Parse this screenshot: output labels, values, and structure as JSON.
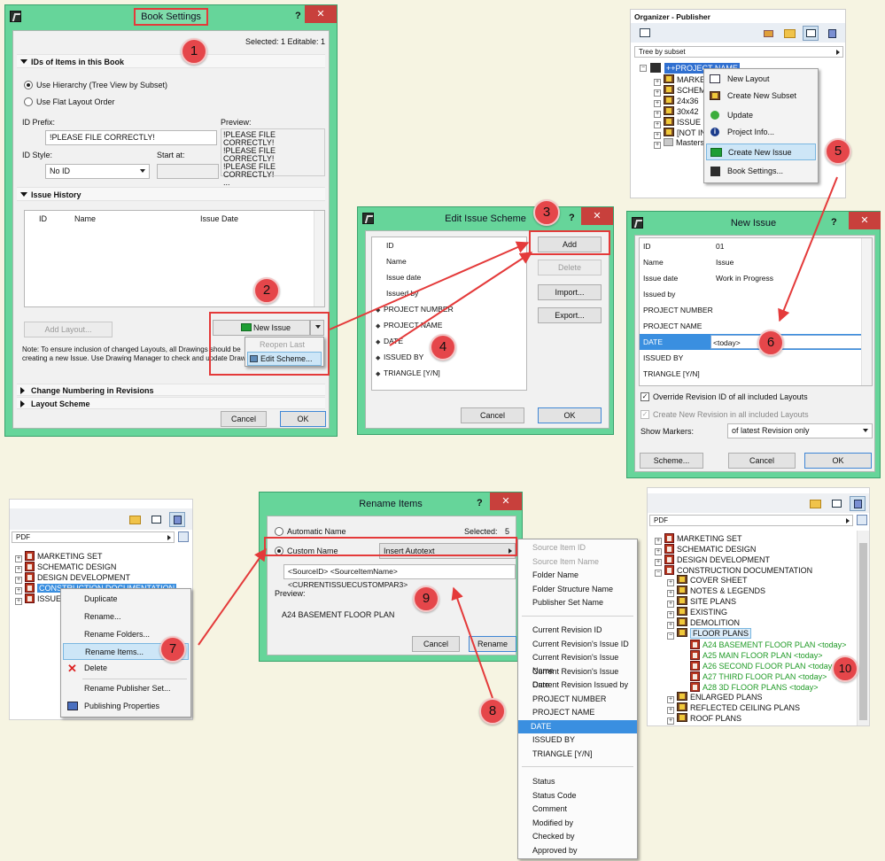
{
  "book_settings": {
    "title": "Book Settings",
    "help": "?",
    "close": "✕",
    "selected_info": "Selected: 1  Editable: 1",
    "ids_section": "IDs of Items in this Book",
    "radio_hierarchy": "Use Hierarchy (Tree View by Subset)",
    "radio_flat": "Use Flat Layout Order",
    "id_prefix_label": "ID Prefix:",
    "id_prefix_value": "!PLEASE FILE CORRECTLY!",
    "preview_label": "Preview:",
    "preview_lines": [
      "!PLEASE FILE CORRECTLY!",
      "!PLEASE FILE CORRECTLY!",
      "!PLEASE FILE CORRECTLY!",
      "..."
    ],
    "id_style_label": "ID Style:",
    "id_style_value": "No ID",
    "start_at_label": "Start at:",
    "issue_history": "Issue History",
    "col_id": "ID",
    "col_name": "Name",
    "col_date": "Issue Date",
    "add_layout": "Add Layout...",
    "new_issue": "New Issue",
    "note": "Note: To ensure inclusion of changed Layouts, all Drawings should be creating a new Issue. Use Drawing Manager to check and update Draw",
    "menu_reopen": "Reopen Last Issue",
    "menu_edit_scheme": "Edit Scheme...",
    "change_numbering": "Change Numbering in Revisions",
    "layout_scheme": "Layout Scheme",
    "cancel": "Cancel",
    "ok": "OK"
  },
  "edit_issue_scheme": {
    "title": "Edit Issue Scheme",
    "help": "?",
    "close": "✕",
    "items": [
      "ID",
      "Name",
      "Issue date",
      "Issued by",
      "PROJECT NUMBER",
      "PROJECT NAME",
      "DATE",
      "ISSUED BY",
      "TRIANGLE [Y/N]"
    ],
    "add": "Add",
    "delete": "Delete",
    "import": "Import...",
    "export": "Export...",
    "cancel": "Cancel",
    "ok": "OK"
  },
  "organizer": {
    "title": "Organizer - Publisher",
    "view_select": "Tree by subset",
    "root": "++PROJECT NAME",
    "tree": [
      "MARKET",
      "SCHEMA",
      "24x36",
      "30x42",
      "ISSUE R",
      "[NOT IN",
      "Masters"
    ],
    "menu": [
      "New Layout",
      "Create New Subset",
      "Update",
      "Project Info...",
      "Create New Issue",
      "Book Settings..."
    ]
  },
  "new_issue": {
    "title": "New Issue",
    "help": "?",
    "close": "✕",
    "rows": [
      {
        "k": "ID",
        "v": "01"
      },
      {
        "k": "Name",
        "v": "Issue"
      },
      {
        "k": "Issue date",
        "v": "Work in Progress"
      },
      {
        "k": "Issued by",
        "v": ""
      },
      {
        "k": "PROJECT NUMBER",
        "v": ""
      },
      {
        "k": "PROJECT NAME",
        "v": ""
      },
      {
        "k": "DATE",
        "v": "<today>"
      },
      {
        "k": "ISSUED BY",
        "v": ""
      },
      {
        "k": "TRIANGLE [Y/N]",
        "v": ""
      }
    ],
    "override": "Override Revision ID of all included Layouts",
    "create_rev": "Create New Revision in all included Layouts",
    "show_markers": "Show Markers:",
    "markers_value": "of latest Revision only",
    "scheme": "Scheme...",
    "cancel": "Cancel",
    "ok": "OK"
  },
  "publisher_left": {
    "set": "PDF",
    "tree": [
      "MARKETING SET",
      "SCHEMATIC DESIGN",
      "DESIGN DEVELOPMENT",
      "CONSTRUCTION DOCUMENTATION",
      "ISSUE"
    ],
    "menu": [
      "Duplicate",
      "Rename...",
      "Rename Folders...",
      "Rename Items...",
      "Delete",
      "Rename Publisher Set...",
      "Publishing Properties"
    ]
  },
  "rename_items": {
    "title": "Rename Items",
    "help": "?",
    "close": "✕",
    "automatic": "Automatic Name",
    "selected": "Selected:",
    "selected_count": "5",
    "custom": "Custom Name",
    "insert_autotext": "Insert Autotext",
    "pattern": "<SourceID> <SourceItemName> <CURRENTISSUECUSTOMPAR3>",
    "preview_label": "Preview:",
    "preview_value": "A24 BASEMENT FLOOR PLAN",
    "cancel": "Cancel",
    "rename": "Rename"
  },
  "autotext_menu": {
    "g1": [
      "Source Item ID",
      "Source Item Name",
      "Folder Name",
      "Folder Structure Name",
      "Publisher Set Name"
    ],
    "g2": [
      "Current Revision ID",
      "Current Revision's Issue ID",
      "Current Revision's Issue Name",
      "Current Revision's Issue Date",
      "Current Revision Issued by",
      "PROJECT NUMBER",
      "PROJECT NAME",
      "DATE",
      "ISSUED BY",
      "TRIANGLE [Y/N]"
    ],
    "g3": [
      "Status",
      "Status Code",
      "Comment",
      "Modified by",
      "Checked by",
      "Approved by"
    ]
  },
  "publisher_right": {
    "set": "PDF",
    "tree": [
      "MARKETING SET",
      "SCHEMATIC DESIGN",
      "DESIGN DEVELOPMENT",
      "CONSTRUCTION DOCUMENTATION",
      "COVER SHEET",
      "NOTES & LEGENDS",
      "SITE PLANS",
      "EXISTING",
      "DEMOLITION",
      "FLOOR PLANS",
      "A24 BASEMENT FLOOR PLAN <today>",
      "A25 MAIN FLOOR PLAN <today>",
      "A26 SECOND FLOOR PLAN <today>",
      "A27 THIRD FLOOR PLAN <today>",
      "A28 3D FLOOR PLANS <today>",
      "ENLARGED PLANS",
      "REFLECTED CEILING PLANS",
      "ROOF PLANS"
    ]
  },
  "badges": [
    "1",
    "2",
    "3",
    "4",
    "5",
    "6",
    "7",
    "8",
    "9",
    "10"
  ],
  "colors": {
    "window": "#66d59a",
    "close": "#c8403c",
    "badge": "#e5464a",
    "highlight": "#e43a3a",
    "green_text": "#1f9a26"
  }
}
